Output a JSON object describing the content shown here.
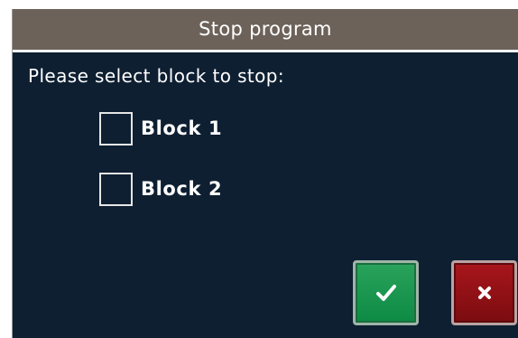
{
  "dialog": {
    "title": "Stop program",
    "prompt": "Please select block to stop:"
  },
  "options": [
    {
      "label": "Block 1",
      "checked": false
    },
    {
      "label": "Block 2",
      "checked": false
    }
  ],
  "buttons": {
    "confirm_icon": "checkmark-icon",
    "cancel_icon": "x-icon"
  },
  "colors": {
    "background": "#0e1f32",
    "titlebar": "#6d625a",
    "confirm": "#0d8a44",
    "cancel": "#7a0c10"
  }
}
